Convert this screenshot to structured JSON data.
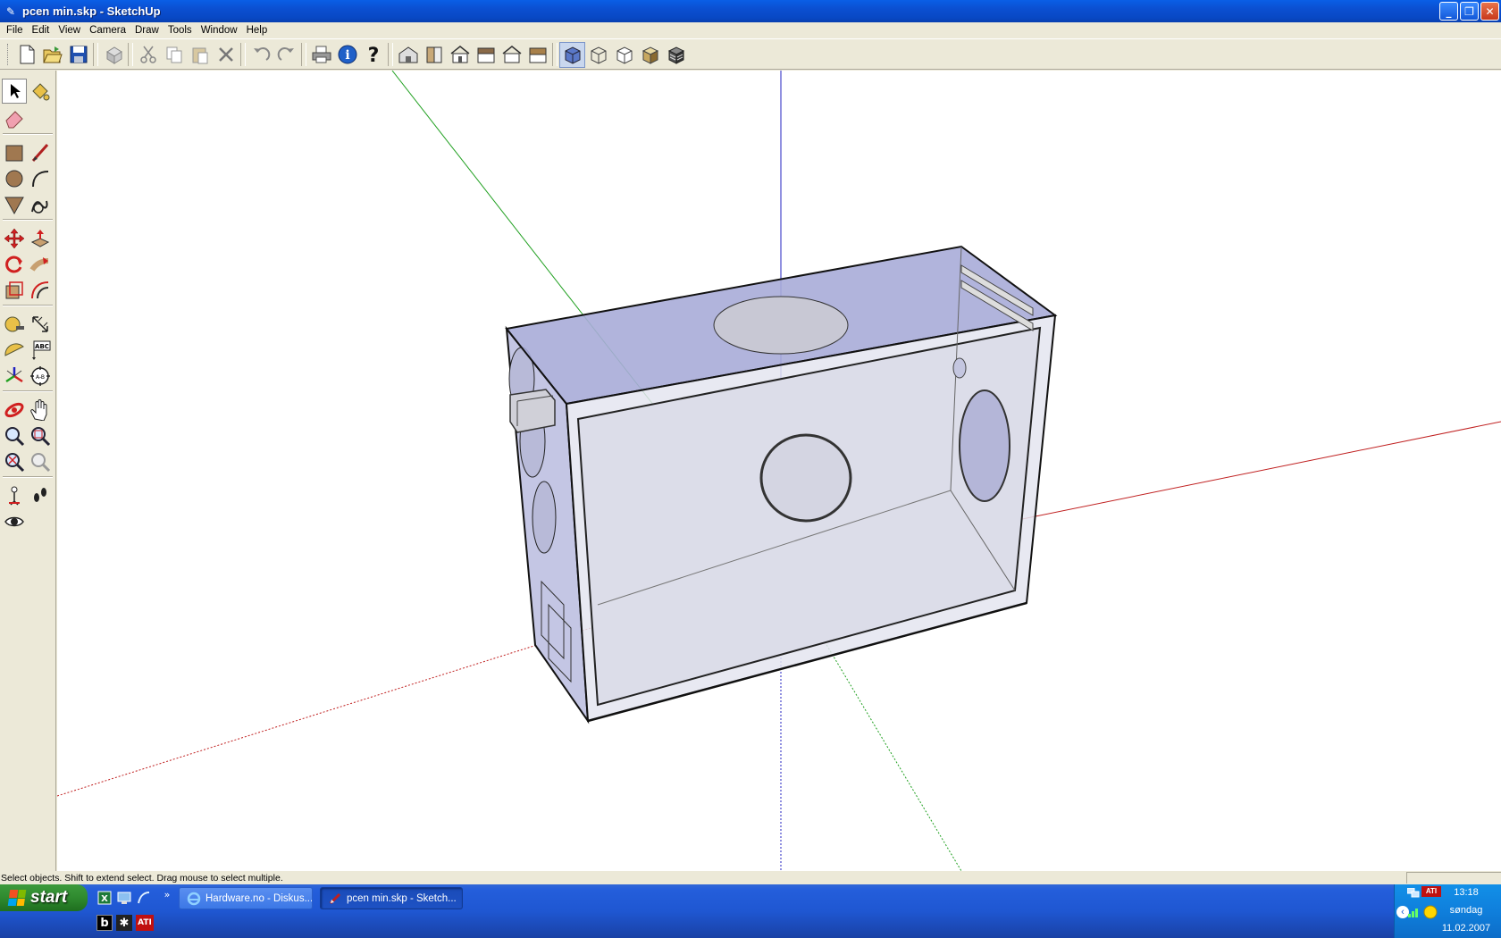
{
  "window": {
    "title": "pcen min.skp - SketchUp",
    "min_glyph": "_",
    "max_glyph": "❐",
    "close_glyph": "✕"
  },
  "menu": [
    "File",
    "Edit",
    "View",
    "Camera",
    "Draw",
    "Tools",
    "Window",
    "Help"
  ],
  "toolbar_icons": [
    "new-icon",
    "open-icon",
    "save-icon",
    "make-component-icon",
    "cut-icon",
    "copy-icon",
    "paste-icon",
    "erase-icon",
    "undo-icon",
    "redo-icon",
    "print-icon",
    "model-info-icon",
    "help-icon",
    "iso-view-icon",
    "top-view-icon",
    "front-view-icon",
    "right-view-icon",
    "back-view-icon",
    "left-view-icon",
    "xray-icon",
    "wireframe-icon",
    "hidden-line-icon",
    "shaded-icon",
    "shaded-textures-icon"
  ],
  "left_tools": [
    "select",
    "paint-bucket",
    "eraser",
    "rectangle",
    "line",
    "circle",
    "arc",
    "polygon",
    "freehand",
    "move",
    "push-pull",
    "rotate",
    "follow-me",
    "scale",
    "offset",
    "tape-measure",
    "dimension",
    "protractor",
    "text",
    "axes",
    "3d-text",
    "orbit",
    "pan",
    "zoom",
    "zoom-window",
    "zoom-extents",
    "previous-view",
    "position-camera",
    "walk",
    "look-around"
  ],
  "colors": {
    "red_axis": "#c02020",
    "green_axis": "#20a020",
    "blue_axis": "#2020c0",
    "face_top": "#b0b4dc",
    "face_side": "#c8cae6",
    "glass": "#e6e7f2"
  },
  "statusbar": {
    "message": "Select objects. Shift to extend select. Drag mouse to select multiple.",
    "measurement": ""
  },
  "taskbar": {
    "start_label": "start",
    "chevron": "»",
    "tasks": [
      {
        "label": "Hardware.no - Diskus...",
        "icon": "ie-icon",
        "active": false
      },
      {
        "label": "pcen min.skp - Sketch...",
        "icon": "sketchup-icon",
        "active": true
      }
    ],
    "tray": {
      "ati": "ATI",
      "time": "13:18",
      "day": "søndag",
      "date": "11.02.2007"
    }
  }
}
